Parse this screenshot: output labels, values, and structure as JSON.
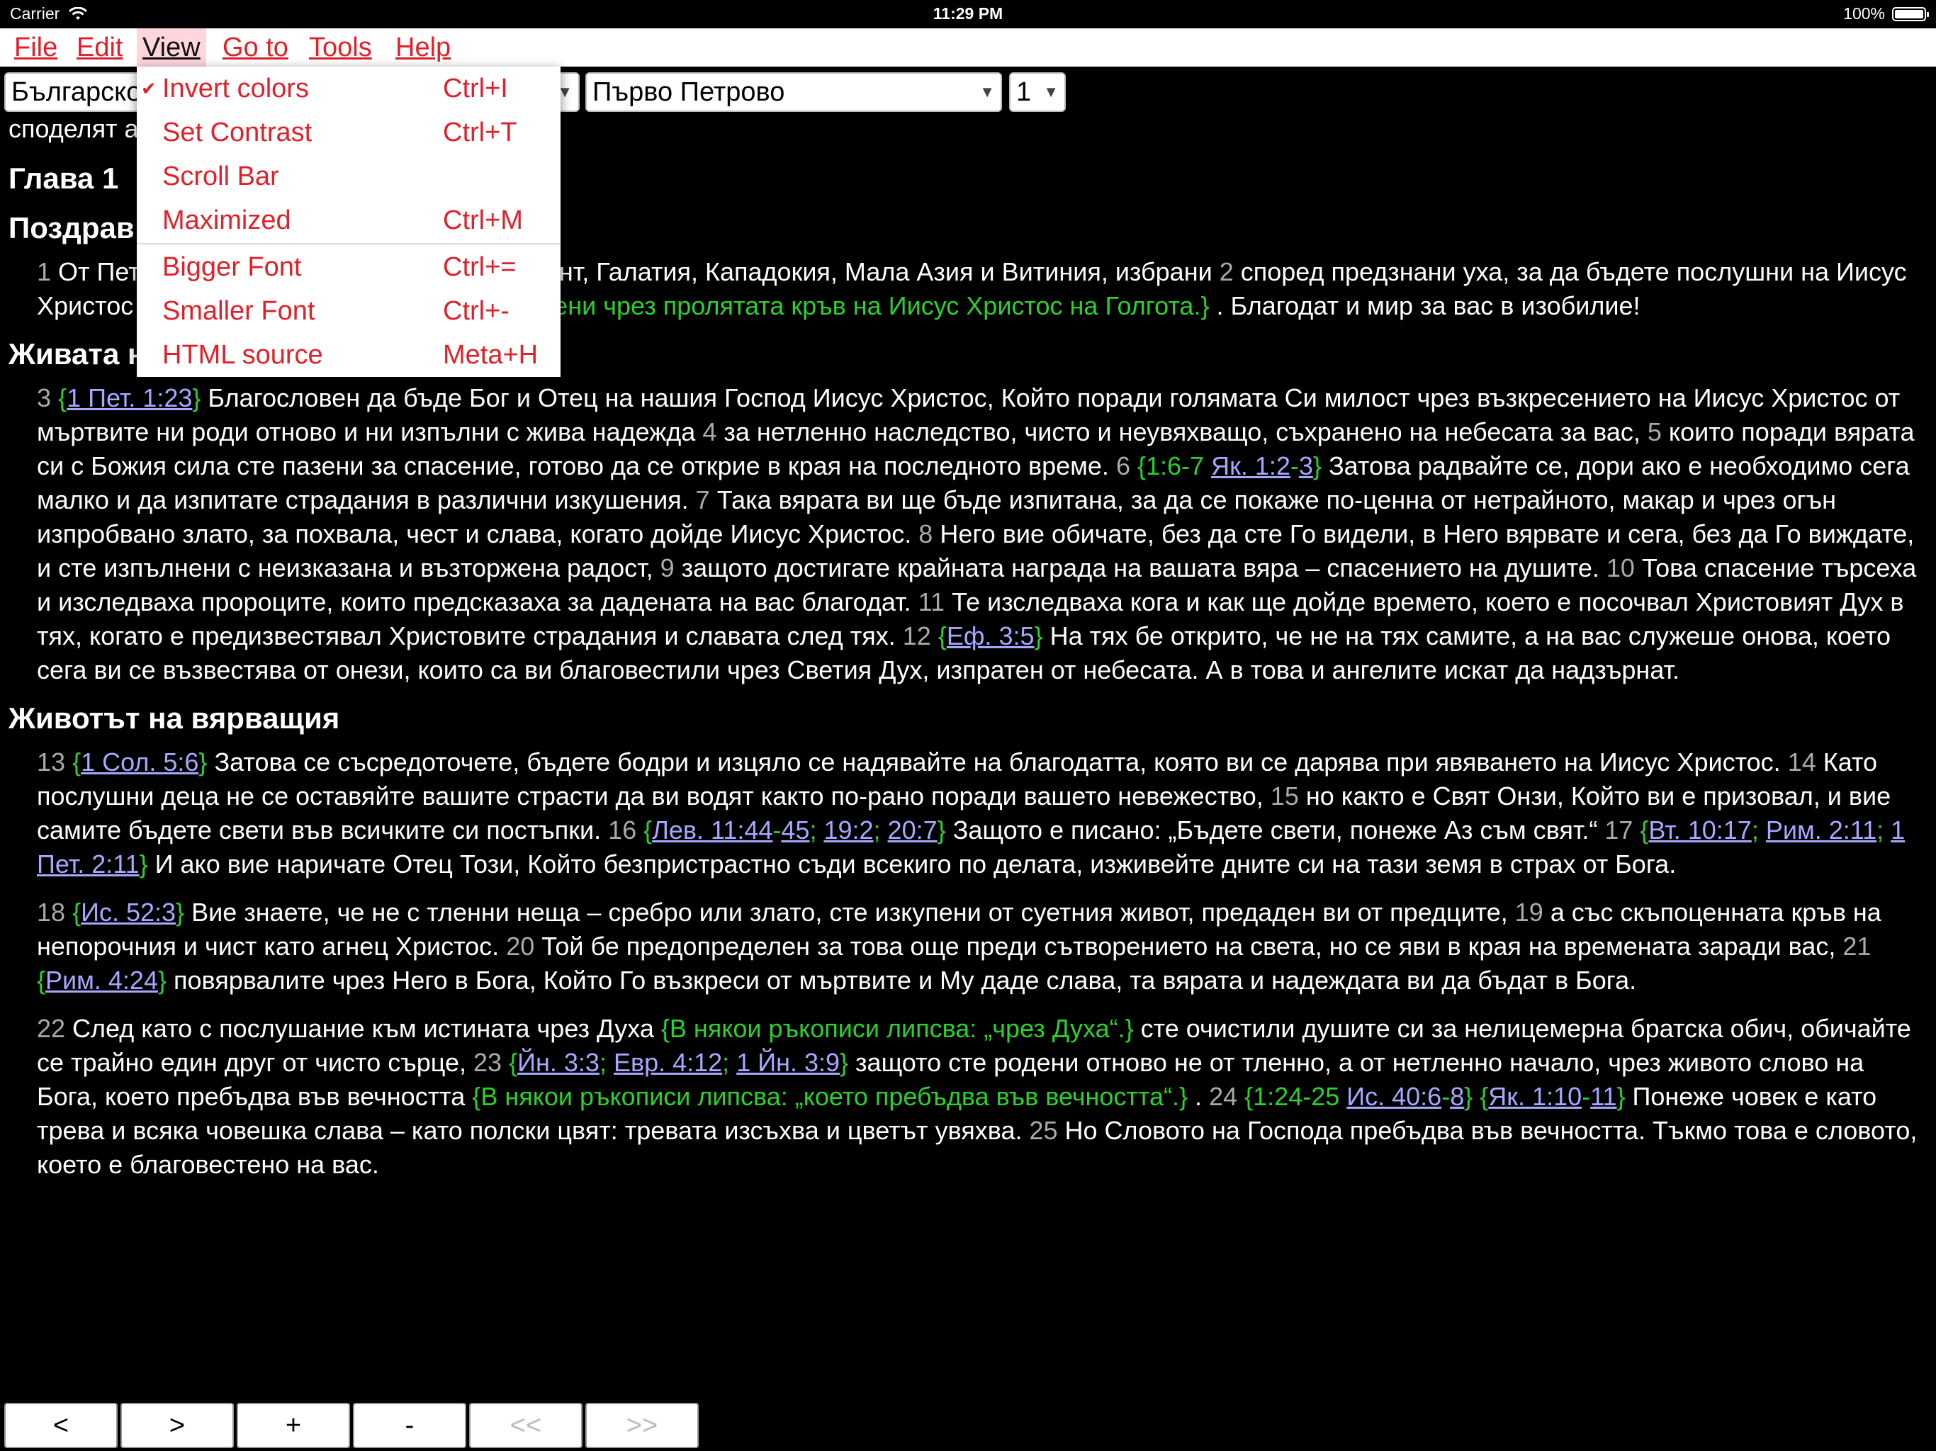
{
  "status": {
    "carrier": "Carrier",
    "time": "11:29 PM",
    "battery": "100%",
    "battery_level": 1.0
  },
  "menubar": {
    "items": [
      {
        "label": "File",
        "key": "F"
      },
      {
        "label": "Edit",
        "key": "E"
      },
      {
        "label": "View",
        "key": "V",
        "open": true
      },
      {
        "label": "Go to",
        "key": "G"
      },
      {
        "label": "Tools",
        "key": "T"
      },
      {
        "label": "Help",
        "key": "H"
      }
    ]
  },
  "toolbar": {
    "translation": "Българско",
    "book": "Първо Петрово",
    "chapter": "1"
  },
  "view_menu": {
    "items": [
      {
        "label": "Invert colors",
        "shortcut": "Ctrl+I",
        "checked": true
      },
      {
        "label": "Set Contrast",
        "shortcut": "Ctrl+T"
      },
      {
        "label": "Scroll Bar",
        "shortcut": ""
      },
      {
        "label": "Maximized",
        "shortcut": "Ctrl+M"
      },
      {
        "label": "Bigger Font",
        "shortcut": "Ctrl+="
      },
      {
        "label": "Smaller Font",
        "shortcut": "Ctrl+-"
      },
      {
        "label": "HTML source",
        "shortcut": "Meta+H"
      }
    ]
  },
  "content": {
    "intro_visible": "споделят а да участват и в славата Му (4:13).",
    "chapter_title": "Глава 1",
    "h_greeting": "Поздрав",
    "p1": [
      {
        "t": "vn",
        "v": "1"
      },
      {
        "t": "tx",
        "v": " От Пет  о преселниците, разпръснати в Понт, Галатия, Кападокия, Мала Азия и Витиния, избрани "
      },
      {
        "t": "vn",
        "v": "2"
      },
      {
        "t": "tx",
        "v": " според предзнани  уха, за да бъдете послушни на Иисус Христос и поръсени с кръвта Му "
      },
      {
        "t": "note",
        "v": "{Т.е. простени чрез пролятата кръв на Иисус Христос на Голгота.}"
      },
      {
        "t": "tx",
        "v": " . Благодат и мир за вас в изобилие!"
      }
    ],
    "h_hope": "Живата надежда",
    "p2": [
      {
        "t": "vn",
        "v": "3"
      },
      {
        "t": "tx",
        "v": " "
      },
      {
        "t": "note",
        "v": "{"
      },
      {
        "t": "ref",
        "v": "1 Пет. 1:23"
      },
      {
        "t": "note",
        "v": "}"
      },
      {
        "t": "tx",
        "v": " Благословен да бъде Бог и Отец на нашия Господ Иисус Христос, Който поради голямата Си милост чрез възкресението на Иисус Христос от мъртвите ни роди отново и ни изпълни с жива надежда "
      },
      {
        "t": "vn",
        "v": "4"
      },
      {
        "t": "tx",
        "v": " за нетленно наследство, чисто и неувяхващо, съхранено на небесата за вас, "
      },
      {
        "t": "vn",
        "v": "5"
      },
      {
        "t": "tx",
        "v": " които поради вярата си с Божия сила сте пазени за спасение, готово да се открие в края на последното време. "
      },
      {
        "t": "vn",
        "v": "6"
      },
      {
        "t": "tx",
        "v": " "
      },
      {
        "t": "note",
        "v": "{1:6-7 "
      },
      {
        "t": "ref",
        "v": "Як. 1:2"
      },
      {
        "t": "note",
        "v": "-"
      },
      {
        "t": "ref",
        "v": "3"
      },
      {
        "t": "note",
        "v": "}"
      },
      {
        "t": "tx",
        "v": " Затова радвайте се, дори ако е необходимо сега малко и да изпитате страдания в различни изкушения. "
      },
      {
        "t": "vn",
        "v": "7"
      },
      {
        "t": "tx",
        "v": " Така вярата ви ще бъде изпитана, за да се покаже по-ценна от нетрайното, макар и чрез огън изпробвано злато, за похвала, чест и слава, когато дойде Иисус Христос. "
      },
      {
        "t": "vn",
        "v": "8"
      },
      {
        "t": "tx",
        "v": " Него вие обичате, без да сте Го видели, в Него вярвате и сега, без да Го виждате, и сте изпълнени с неизказана и възторжена радост, "
      },
      {
        "t": "vn",
        "v": "9"
      },
      {
        "t": "tx",
        "v": " защото достигате крайната награда на вашата вяра – спасението на душите. "
      },
      {
        "t": "vn",
        "v": "10"
      },
      {
        "t": "tx",
        "v": " Това спасение търсеха и изследваха пророците, които предсказаха за дадената на вас благодат. "
      },
      {
        "t": "vn",
        "v": "11"
      },
      {
        "t": "tx",
        "v": " Те изследваха кога и как ще дойде времето, което е посочвал Христовият Дух в тях, когато е предизвестявал Христовите страдания и славата след тях. "
      },
      {
        "t": "vn",
        "v": "12"
      },
      {
        "t": "tx",
        "v": " "
      },
      {
        "t": "note",
        "v": "{"
      },
      {
        "t": "ref",
        "v": "Еф. 3:5"
      },
      {
        "t": "note",
        "v": "}"
      },
      {
        "t": "tx",
        "v": " На тях бе открито, че не на тях самите, а на вас служеше онова, което сега ви се възвестява от онези, които са ви благовестили чрез Светия Дух, изпратен от небесата. А в това и ангелите искат да надзърнат."
      }
    ],
    "h_life": "Животът на вярващия",
    "p3": [
      {
        "t": "vn",
        "v": "13"
      },
      {
        "t": "tx",
        "v": " "
      },
      {
        "t": "note",
        "v": "{"
      },
      {
        "t": "ref",
        "v": "1 Сол. 5:6"
      },
      {
        "t": "note",
        "v": "}"
      },
      {
        "t": "tx",
        "v": " Затова се съсредоточете, бъдете бодри и изцяло се надявайте на благодатта, която ви се дарява при явяването на Иисус Христос. "
      },
      {
        "t": "vn",
        "v": "14"
      },
      {
        "t": "tx",
        "v": " Като послушни деца не се оставяйте вашите страсти да ви водят както по-рано поради вашето невежество, "
      },
      {
        "t": "vn",
        "v": "15"
      },
      {
        "t": "tx",
        "v": " но както е Свят Онзи, Който ви е призовал, и вие самите бъдете свети във всичките си постъпки. "
      },
      {
        "t": "vn",
        "v": "16"
      },
      {
        "t": "tx",
        "v": " "
      },
      {
        "t": "note",
        "v": "{"
      },
      {
        "t": "ref",
        "v": "Лев. 11:44"
      },
      {
        "t": "note",
        "v": "-"
      },
      {
        "t": "ref",
        "v": "45"
      },
      {
        "t": "note",
        "v": "; "
      },
      {
        "t": "ref",
        "v": "19:2"
      },
      {
        "t": "note",
        "v": "; "
      },
      {
        "t": "ref",
        "v": "20:7"
      },
      {
        "t": "note",
        "v": "}"
      },
      {
        "t": "tx",
        "v": " Защото е писано: „Бъдете свети, понеже Аз съм свят.“ "
      },
      {
        "t": "vn",
        "v": "17"
      },
      {
        "t": "tx",
        "v": " "
      },
      {
        "t": "note",
        "v": "{"
      },
      {
        "t": "ref",
        "v": "Вт. 10:17"
      },
      {
        "t": "note",
        "v": "; "
      },
      {
        "t": "ref",
        "v": "Рим. 2:11"
      },
      {
        "t": "note",
        "v": "; "
      },
      {
        "t": "ref",
        "v": "1 Пет. 2:11"
      },
      {
        "t": "note",
        "v": "}"
      },
      {
        "t": "tx",
        "v": " И ако вие наричате Отец Този, Който безпристрастно съди всекиго по делата, изживейте дните си на тази земя в страх от Бога."
      }
    ],
    "p4": [
      {
        "t": "vn",
        "v": "18"
      },
      {
        "t": "tx",
        "v": " "
      },
      {
        "t": "note",
        "v": "{"
      },
      {
        "t": "ref",
        "v": "Ис. 52:3"
      },
      {
        "t": "note",
        "v": "}"
      },
      {
        "t": "tx",
        "v": " Вие знаете, че не с тленни неща – сребро или злато, сте изкупени от суетния живот, предаден ви от предците, "
      },
      {
        "t": "vn",
        "v": "19"
      },
      {
        "t": "tx",
        "v": " а със скъпоценната кръв на непорочния и чист като агнец Христос. "
      },
      {
        "t": "vn",
        "v": "20"
      },
      {
        "t": "tx",
        "v": " Той бе предопределен за това още преди сътворението на света, но се яви в края на времената заради вас, "
      },
      {
        "t": "vn",
        "v": "21"
      },
      {
        "t": "tx",
        "v": " "
      },
      {
        "t": "note",
        "v": "{"
      },
      {
        "t": "ref",
        "v": "Рим. 4:24"
      },
      {
        "t": "note",
        "v": "}"
      },
      {
        "t": "tx",
        "v": " повярвалите чрез Него в Бога, Който Го възкреси от мъртвите и Му даде слава, та вярата и надеждата ви да бъдат в Бога."
      }
    ],
    "p5": [
      {
        "t": "vn",
        "v": "22"
      },
      {
        "t": "tx",
        "v": " След като с послушание към истината чрез Духа "
      },
      {
        "t": "note",
        "v": "{В някои ръкописи липсва: „чрез Духа“.}"
      },
      {
        "t": "tx",
        "v": " сте очистили душите си за нелицемерна братска обич, обичайте се трайно един друг от чисто сърце, "
      },
      {
        "t": "vn",
        "v": "23"
      },
      {
        "t": "tx",
        "v": " "
      },
      {
        "t": "note",
        "v": "{"
      },
      {
        "t": "ref",
        "v": "Йн. 3:3"
      },
      {
        "t": "note",
        "v": "; "
      },
      {
        "t": "ref",
        "v": "Евр. 4:12"
      },
      {
        "t": "note",
        "v": "; "
      },
      {
        "t": "ref",
        "v": "1 Йн. 3:9"
      },
      {
        "t": "note",
        "v": "}"
      },
      {
        "t": "tx",
        "v": " защото сте родени отново не от тленно, а от нетленно начало, чрез живото слово на Бога, което пребъдва във вечността "
      },
      {
        "t": "note",
        "v": "{В някои ръкописи липсва: „което пребъдва във вечността“.}"
      },
      {
        "t": "tx",
        "v": " . "
      },
      {
        "t": "vn",
        "v": "24"
      },
      {
        "t": "tx",
        "v": " "
      },
      {
        "t": "note",
        "v": "{1:24-25 "
      },
      {
        "t": "ref",
        "v": "Ис. 40:6"
      },
      {
        "t": "note",
        "v": "-"
      },
      {
        "t": "ref",
        "v": "8"
      },
      {
        "t": "note",
        "v": "} {"
      },
      {
        "t": "ref",
        "v": "Як. 1:10"
      },
      {
        "t": "note",
        "v": "-"
      },
      {
        "t": "ref",
        "v": "11"
      },
      {
        "t": "note",
        "v": "}"
      },
      {
        "t": "tx",
        "v": " Понеже човек е като трева и всяка човешка слава – като полски цвят: тревата изсъхва и цветът увяхва. "
      },
      {
        "t": "vn",
        "v": "25"
      },
      {
        "t": "tx",
        "v": " Но Словото на Господа пребъдва във вечността. Тъкмо това е словото, което е благовестено на вас."
      }
    ]
  },
  "nav": {
    "prev": "<",
    "next": ">",
    "plus": "+",
    "minus": "-",
    "first": "<<",
    "last": ">>"
  },
  "colors": {
    "menu_text": "#e0202a",
    "note": "#2bd12b",
    "ref": "#a7a7ff",
    "verse_num": "#aaaaaa",
    "menu_open_bg": "#ffd6dc"
  }
}
